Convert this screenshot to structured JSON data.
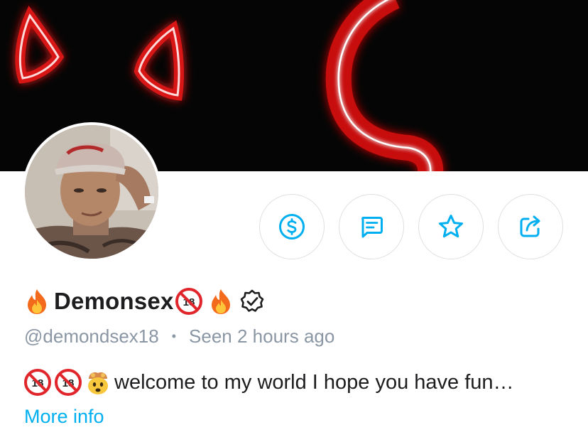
{
  "profile": {
    "display_name": "Demonsex",
    "handle": "@demondsex18",
    "last_seen": "Seen 2 hours ago",
    "separator": "•",
    "bio": "welcome to my world I hope you have fun…",
    "more_info_label": "More info",
    "verified": true
  },
  "actions": [
    {
      "name": "tip",
      "icon": "dollar-icon"
    },
    {
      "name": "message",
      "icon": "message-icon"
    },
    {
      "name": "favorite",
      "icon": "star-icon"
    },
    {
      "name": "share",
      "icon": "share-icon"
    }
  ],
  "colors": {
    "accent": "#00aff0",
    "text": "#1d1d1f",
    "muted": "#8a96a3",
    "button_border": "#dcdfe3",
    "cover_bg": "#050505",
    "neon_red": "#e01818"
  }
}
